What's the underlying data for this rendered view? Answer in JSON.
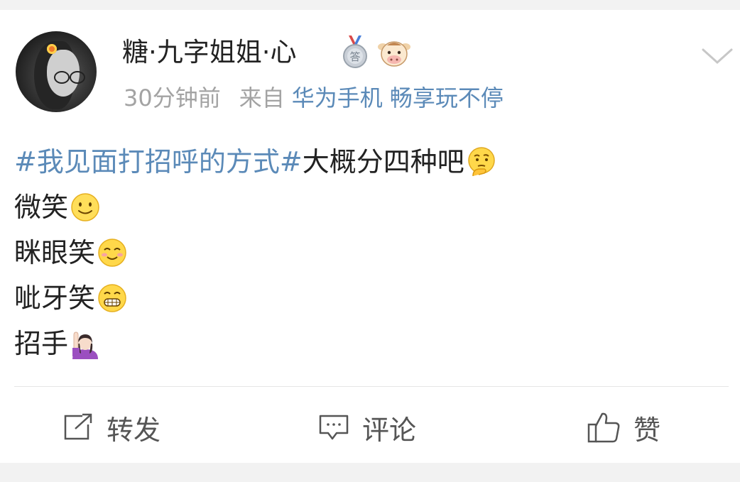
{
  "post": {
    "username": "糖·九字姐姐·心",
    "time": "30分钟前",
    "from_label": "来自",
    "device": "华为手机 畅享玩不停",
    "hashtag": "#我见面打招呼的方式#",
    "intro": "大概分四种吧",
    "lines": [
      {
        "text": "微笑",
        "emoji": "smile-emoji"
      },
      {
        "text": "眯眼笑",
        "emoji": "squint-smile-emoji"
      },
      {
        "text": "呲牙笑",
        "emoji": "grin-emoji"
      },
      {
        "text": "招手",
        "emoji": "raising-hand-emoji"
      }
    ],
    "intro_emoji": "thinking-emoji"
  },
  "badges": [
    "medal-badge-icon",
    "cow-emblem-icon"
  ],
  "actions": {
    "repost_label": "转发",
    "comment_label": "评论",
    "like_label": "赞"
  },
  "colors": {
    "link": "#5b8ab8",
    "meta_gray": "#a3a3a3",
    "text": "#222222",
    "action_text": "#555555",
    "bg_strip": "#f2f2f2"
  }
}
